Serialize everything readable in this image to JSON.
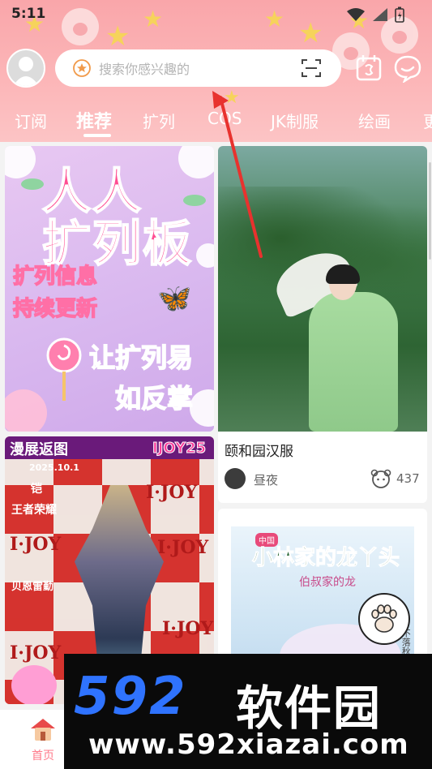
{
  "status_bar": {
    "time": "5:11"
  },
  "search": {
    "placeholder": "搜索你感兴趣的"
  },
  "tabs": [
    {
      "label": "订阅"
    },
    {
      "label": "推荐"
    },
    {
      "label": "扩列"
    },
    {
      "label": "COS"
    },
    {
      "label": "JK制服"
    },
    {
      "label": "绘画"
    },
    {
      "label": "更"
    }
  ],
  "active_tab": "推荐",
  "feed": {
    "promo": {
      "line1": "人人",
      "line2": "扩列板",
      "line3": "扩列信息",
      "line4": "持续更新",
      "line5": "让扩列易",
      "line6": "如反掌"
    },
    "post_hanfu": {
      "title": "颐和园汉服",
      "author": "昼夜",
      "likes": "437"
    },
    "post_expo": {
      "header": "漫展返图",
      "logo": "IJOY25",
      "date": "2025.10.1",
      "character1": "铠",
      "character2": "王者荣耀",
      "user": "贝恩雷勤",
      "brand": "I·JOY"
    },
    "post_art": {
      "tag": "中国",
      "title": "小林家的龙丫头",
      "subtitle": "伯叔家的龙",
      "side_text": "不落秋暮"
    }
  },
  "bottom_nav": {
    "home_label": "首页"
  },
  "watermark": {
    "brand_number": "592",
    "brand_cn": "软件园",
    "url": "www.592xiazai.com"
  },
  "colors": {
    "header_pink": "#f9a6aa",
    "accent_pink": "#ff7a8a",
    "watermark_blue": "#2f73ff"
  }
}
